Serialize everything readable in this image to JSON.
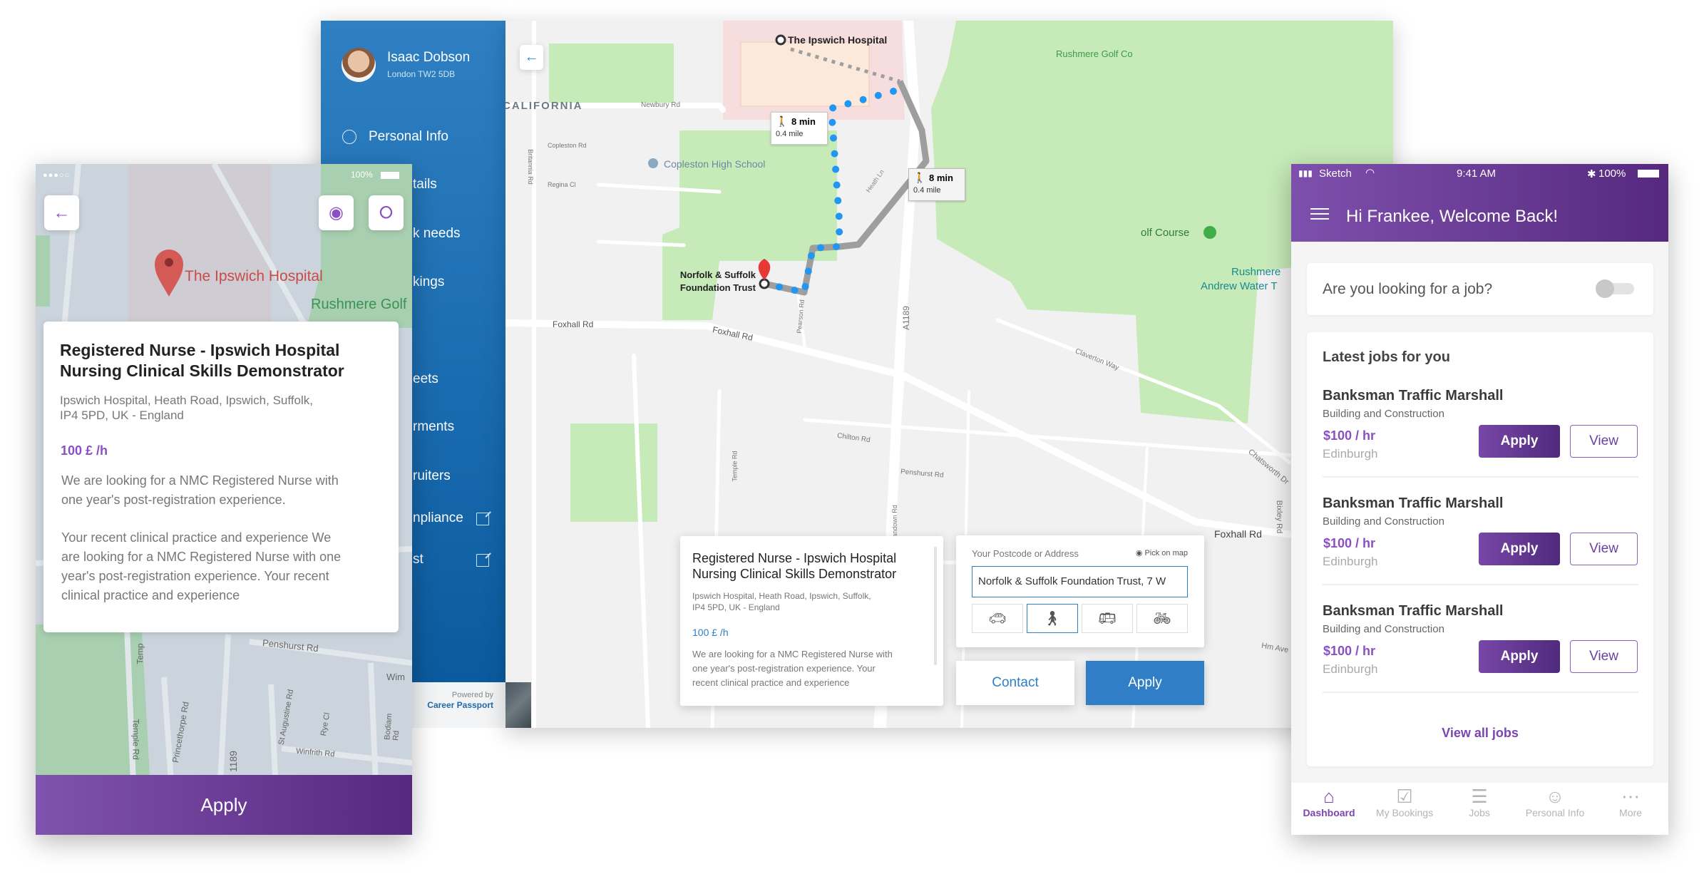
{
  "sidebar": {
    "user_name": "Isaac Dobson",
    "user_location": "London TW2 5DB",
    "items": [
      {
        "label": "Personal Info",
        "icon": "person-circle-icon"
      },
      {
        "label": "tails"
      },
      {
        "label": "k needs"
      },
      {
        "label": "kings"
      },
      {
        "label": "eets"
      },
      {
        "label": "rments"
      },
      {
        "label": "ruiters"
      },
      {
        "label": "npliance",
        "icon": "external-link-icon"
      },
      {
        "label": "st",
        "icon": "external-link-icon"
      }
    ],
    "powered_by": "Powered by",
    "brand": "Career Passport"
  },
  "map": {
    "destination": "The Ipswich Hospital",
    "origin_lines": [
      "Norfolk & Suffolk",
      "Foundation Trust"
    ],
    "route_badges": [
      {
        "time": "8 min",
        "distance": "0.4 mile"
      },
      {
        "time": "8 min",
        "distance": "0.4 mile"
      }
    ],
    "labels": [
      "CALIFORNIA",
      "Newbury Rd",
      "Copleston High School",
      "Copleston Rd",
      "Regina Cl",
      "Britannia Rd",
      "Foxhall Rd",
      "Foxhall Rd",
      "Foxhall Rd",
      "A1189",
      "Pearson Rd",
      "Rushmere Golf Co",
      "olf Course",
      "Rushmere",
      "Andrew Water T",
      "Claverton Way",
      "Chatsworth Dr",
      "Penshurst Rd",
      "Chilton Rd",
      "Temple Rd",
      "Heath Ln",
      "Sandown Rd",
      "Bixley Rd",
      "Hm Ave"
    ],
    "job_card": {
      "title_lines": [
        "Registered Nurse - Ipswich Hospital",
        "Nursing Clinical Skills Demonstrator"
      ],
      "address_lines": [
        "Ipswich Hospital, Heath Road, Ipswich, Suffolk,",
        "IP4 5PD, UK - England"
      ],
      "rate": "100 £ /h",
      "description_lines": [
        "We are looking for a NMC Registered Nurse with",
        "one year's post-registration experience. Your",
        "recent clinical practice and experience"
      ]
    },
    "directions": {
      "label": "Your Postcode or Address",
      "pick_on_map": "Pick on map",
      "address_value": "Norfolk & Suffolk Foundation Trust, 7 W",
      "modes": [
        {
          "name": "car",
          "icon": "car-icon",
          "selected": false
        },
        {
          "name": "walk",
          "icon": "walking-icon",
          "selected": true
        },
        {
          "name": "bus",
          "icon": "bus-icon",
          "selected": false
        },
        {
          "name": "bike",
          "icon": "bicycle-icon",
          "selected": false
        }
      ]
    },
    "contact_label": "Contact",
    "apply_label": "Apply",
    "colors": {
      "accent": "#2f7ec6",
      "route": "#2196f3",
      "park": "#c6eab8"
    }
  },
  "left_phone": {
    "status_battery": "100%",
    "place_label": "The Ipswich Hospital",
    "golf_label": "Rushmere Golf",
    "road_labels": [
      "Penshurst Rd",
      "Temple Rd",
      "Princethorpe Rd",
      "St Augustine Rd",
      "Rye Cl",
      "Winfrith Rd",
      "Bodiam Rd",
      "1189",
      "Wim",
      "Temp"
    ],
    "card": {
      "title_lines": [
        "Registered Nurse - Ipswich Hospital",
        "Nursing Clinical Skills Demonstrator"
      ],
      "address_lines": [
        "Ipswich Hospital, Heath Road, Ipswich, Suffolk,",
        "IP4 5PD, UK - England"
      ],
      "rate": "100 £ /h",
      "paragraph1": [
        "We are looking for a NMC Registered Nurse with",
        "one year's post-registration experience."
      ],
      "paragraph2": [
        "Your recent clinical practice and experience We",
        "are looking for a NMC Registered Nurse with one",
        "year's post-registration experience. Your recent",
        "clinical practice and experience"
      ]
    },
    "apply_label": "Apply",
    "colors": {
      "accent": "#8a4fc4",
      "pin": "#d9534f"
    }
  },
  "right_phone": {
    "status": {
      "carrier": "Sketch",
      "time": "9:41 AM",
      "battery": "100%"
    },
    "header_title": "Hi Frankee, Welcome Back!",
    "job_toggle": {
      "label": "Are you looking for a job?",
      "on": false
    },
    "section_title": "Latest jobs for you",
    "jobs": [
      {
        "title": "Banksman Traffic Marshall",
        "category": "Building and Construction",
        "rate": "$100 / hr",
        "location": "Edinburgh",
        "apply": "Apply",
        "view": "View"
      },
      {
        "title": "Banksman Traffic Marshall",
        "category": "Building and Construction",
        "rate": "$100 / hr",
        "location": "Edinburgh",
        "apply": "Apply",
        "view": "View"
      },
      {
        "title": "Banksman Traffic Marshall",
        "category": "Building and Construction",
        "rate": "$100 / hr",
        "location": "Edinburgh",
        "apply": "Apply",
        "view": "View"
      }
    ],
    "view_all": "View all jobs",
    "tabs": [
      {
        "label": "Dashboard",
        "icon": "home-icon",
        "active": true
      },
      {
        "label": "My Bookings",
        "icon": "calendar-check-icon",
        "active": false
      },
      {
        "label": "Jobs",
        "icon": "list-icon",
        "active": false
      },
      {
        "label": "Personal Info",
        "icon": "person-circle-icon",
        "active": false
      },
      {
        "label": "More",
        "icon": "more-dots-icon",
        "active": false
      }
    ],
    "colors": {
      "primary": "#6a3d9a",
      "header_start": "#7e50ad",
      "header_end": "#56297f"
    }
  }
}
